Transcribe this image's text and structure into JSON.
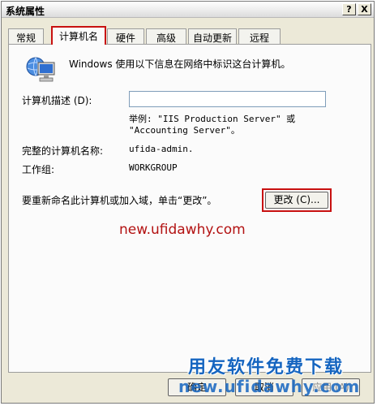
{
  "window": {
    "title": "系统属性",
    "help_glyph": "?",
    "close_glyph": "X"
  },
  "tabs": [
    {
      "label": "常规",
      "active": false
    },
    {
      "label": "计算机名",
      "active": true
    },
    {
      "label": "硬件",
      "active": false
    },
    {
      "label": "高级",
      "active": false
    },
    {
      "label": "自动更新",
      "active": false
    },
    {
      "label": "远程",
      "active": false
    }
  ],
  "panel": {
    "icon": "computer-network-icon",
    "intro": "Windows 使用以下信息在网络中标识这台计算机。",
    "description_label": "计算机描述 (D):",
    "description_value": "",
    "example_line1": "举例: \"IIS Production Server\" 或",
    "example_line2": "\"Accounting Server\"。",
    "full_name_label": "完整的计算机名称:",
    "full_name_value": "ufida-admin.",
    "workgroup_label": "工作组:",
    "workgroup_value": "WORKGROUP",
    "rename_text": "要重新命名此计算机或加入域，单击“更改”。",
    "rename_button": "更改 (C)..."
  },
  "buttons": {
    "ok": "确定",
    "cancel": "取消",
    "apply": "应用 (A)"
  },
  "watermarks": {
    "site_red": "new.ufidawhy.com",
    "brand_blue": "用友软件免费下载",
    "site_blue": "new.ufidawhy.com"
  },
  "colors": {
    "highlight_frame": "#c81010",
    "watermark_red": "#b31212",
    "watermark_blue": "#1565c0",
    "dialog_bg": "#ece9d8"
  }
}
